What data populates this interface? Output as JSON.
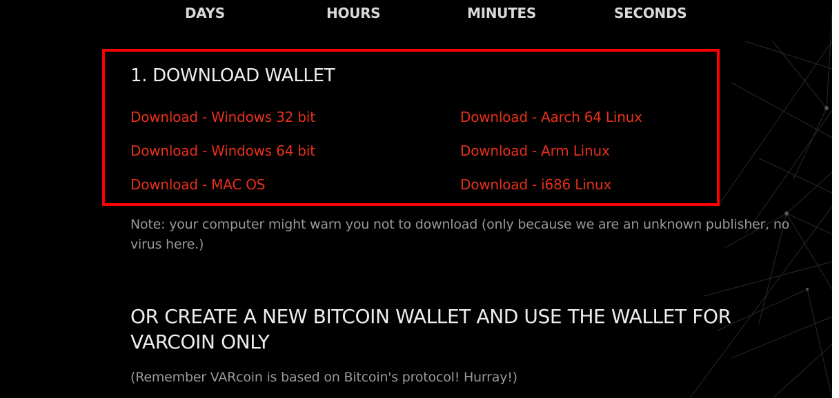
{
  "countdown": {
    "days_label": "DAYS",
    "hours_label": "HOURS",
    "minutes_label": "MINUTES",
    "seconds_label": "SECONDS"
  },
  "download_section": {
    "title": "1. DOWNLOAD WALLET",
    "links": {
      "windows32": "Download - Windows 32 bit",
      "windows64": "Download - Windows 64 bit",
      "macos": "Download - MAC OS",
      "aarch64": "Download - Aarch 64 Linux",
      "arm": "Download - Arm Linux",
      "i686": "Download - i686 Linux"
    },
    "highlight_color": "#ff0000",
    "link_color": "#e8311a"
  },
  "note": "Note: your computer might warn you not to download (only because we are an unknown publisher, no virus here.)",
  "create_wallet": {
    "heading": "OR CREATE A NEW BITCOIN WALLET AND USE THE WALLET FOR VARCOIN ONLY",
    "subtext": "(Remember VARcoin is based on Bitcoin's protocol! Hurray!)"
  }
}
